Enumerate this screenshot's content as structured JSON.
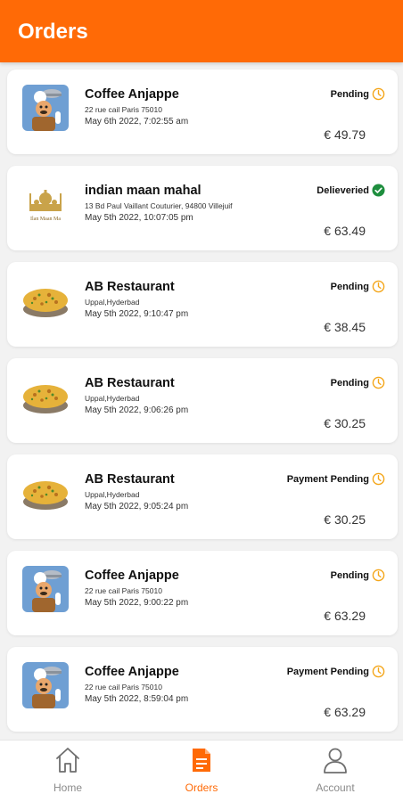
{
  "header": {
    "title": "Orders"
  },
  "orders": [
    {
      "name": "Coffee Anjappe",
      "address": "22 rue cail Paris 75010",
      "date": "May 6th 2022, 7:02:55 am",
      "status": "Pending",
      "price": "€ 49.79",
      "image": "chef-icon"
    },
    {
      "name": "indian maan mahal",
      "address": "13 Bd Paul Vaillant Couturier, 94800 Villejuif",
      "date": "May 5th 2022, 10:07:05 pm",
      "status": "Delieveried",
      "price": "€ 63.49",
      "image": "taj-mahal-logo",
      "logo_text": "Ilan Maan Ma"
    },
    {
      "name": "AB Restaurant",
      "address": "Uppal,Hyderbad",
      "date": "May 5th 2022, 9:10:47 pm",
      "status": "Pending",
      "price": "€ 38.45",
      "image": "biryani-photo"
    },
    {
      "name": "AB Restaurant",
      "address": "Uppal,Hyderbad",
      "date": "May 5th 2022, 9:06:26 pm",
      "status": "Pending",
      "price": "€ 30.25",
      "image": "biryani-photo"
    },
    {
      "name": "AB Restaurant",
      "address": "Uppal,Hyderbad",
      "date": "May 5th 2022, 9:05:24 pm",
      "status": "Payment Pending",
      "price": "€ 30.25",
      "image": "biryani-photo"
    },
    {
      "name": "Coffee Anjappe",
      "address": "22 rue cail Paris 75010",
      "date": "May 5th 2022, 9:00:22 pm",
      "status": "Pending",
      "price": "€ 63.29",
      "image": "chef-icon"
    },
    {
      "name": "Coffee Anjappe",
      "address": "22 rue cail Paris 75010",
      "date": "May 5th 2022, 8:59:04 pm",
      "status": "Payment Pending",
      "price": "€ 63.29",
      "image": "chef-icon"
    }
  ],
  "tabbar": {
    "items": [
      {
        "label": "Home",
        "icon": "home-icon",
        "active": false
      },
      {
        "label": "Orders",
        "icon": "orders-icon",
        "active": true
      },
      {
        "label": "Account",
        "icon": "account-icon",
        "active": false
      }
    ]
  },
  "colors": {
    "accent": "#ff6a06",
    "pending": "#f4a61a",
    "delivered": "#1e8e3e"
  }
}
